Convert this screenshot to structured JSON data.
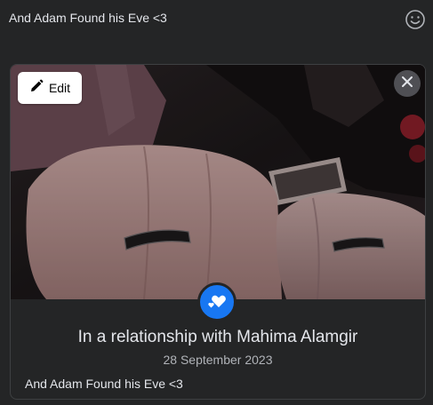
{
  "post": {
    "text": "And Adam Found his Eve <3"
  },
  "icons": {
    "emoji": "smiley-face-icon",
    "edit": "pencil-icon",
    "close": "close-icon",
    "life_event": "hearts-icon"
  },
  "card": {
    "edit_label": "Edit",
    "title": "In a relationship with Mahima Alamgir",
    "date": "28 September 2023",
    "caption": "And Adam Found his Eve <3"
  },
  "colors": {
    "background": "#242526",
    "accent": "#1877f2",
    "text_primary": "#e4e6eb",
    "text_secondary": "#b0b3b8"
  }
}
